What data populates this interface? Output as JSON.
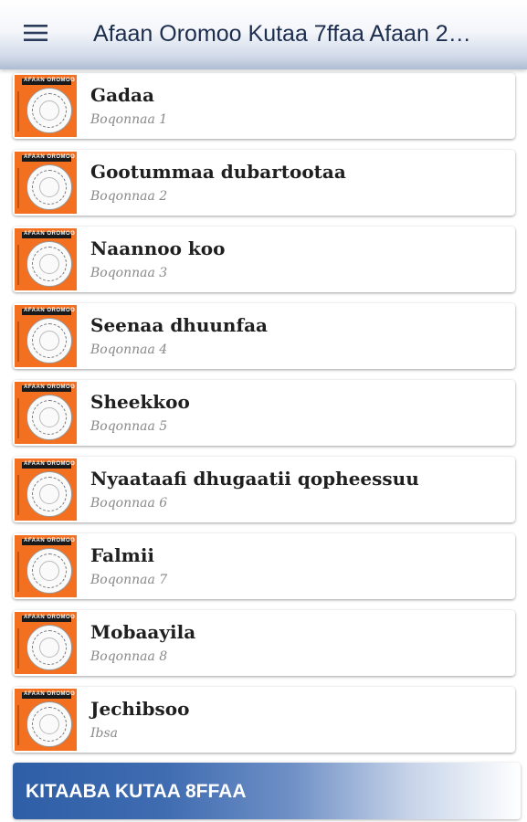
{
  "app_bar": {
    "title": "Afaan Oromoo Kutaa 7ffaa Afaan 2…",
    "menu_icon": "hamburger-menu-icon"
  },
  "colors": {
    "thumbnail_orange": "#f37021",
    "title_text": "#1c2d4e",
    "bottom_button_blue": "#2e5ea6"
  },
  "thumbnail_text": "AFAAN OROMOO",
  "chapters": [
    {
      "title": "Gadaa",
      "subtitle": "Boqonnaa 1"
    },
    {
      "title": "Gootummaa dubartootaa",
      "subtitle": "Boqonnaa 2"
    },
    {
      "title": "Naannoo koo",
      "subtitle": "Boqonnaa 3"
    },
    {
      "title": "Seenaa dhuunfaa",
      "subtitle": "Boqonnaa 4"
    },
    {
      "title": "Sheekkoo",
      "subtitle": "Boqonnaa 5"
    },
    {
      "title": "Nyaataafi dhugaatii qopheessuu",
      "subtitle": "Boqonnaa 6"
    },
    {
      "title": "Falmii",
      "subtitle": "Boqonnaa 7"
    },
    {
      "title": "Mobaayila",
      "subtitle": "Boqonnaa 8"
    },
    {
      "title": "Jechibsoo",
      "subtitle": "Ibsa"
    }
  ],
  "bottom_button": {
    "label": "KITAABA KUTAA 8FFAA"
  }
}
